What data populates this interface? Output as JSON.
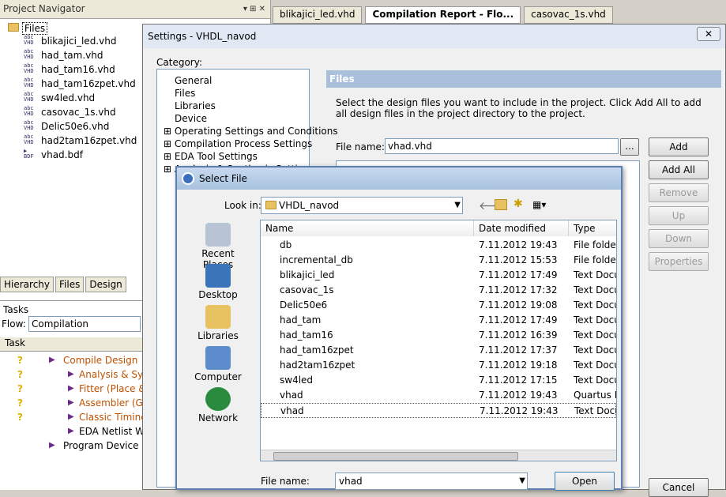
{
  "project_navigator": {
    "title": "Project Navigator",
    "root": "Files",
    "files": [
      {
        "icon": "vhd",
        "name": "blikajici_led.vhd"
      },
      {
        "icon": "vhd",
        "name": "had_tam.vhd"
      },
      {
        "icon": "vhd",
        "name": "had_tam16.vhd"
      },
      {
        "icon": "vhd",
        "name": "had_tam16zpet.vhd"
      },
      {
        "icon": "vhd",
        "name": "sw4led.vhd"
      },
      {
        "icon": "vhd",
        "name": "casovac_1s.vhd"
      },
      {
        "icon": "vhd",
        "name": "Delic50e6.vhd"
      },
      {
        "icon": "vhd",
        "name": "had2tam16zpet.vhd"
      },
      {
        "icon": "bdf",
        "name": "vhad.bdf"
      }
    ],
    "bottom_tabs": [
      "Hierarchy",
      "Files",
      "Design"
    ]
  },
  "top_tabs": [
    "blikajici_led.vhd",
    "Compilation Report - Flo...",
    "casovac_1s.vhd"
  ],
  "tasks": {
    "title": "Tasks",
    "flow_label": "Flow:",
    "flow_value": "Compilation",
    "column": "Task",
    "items": [
      "Compile Design",
      "Analysis & Synth",
      "Fitter (Place & R",
      "Assembler (Gene",
      "Classic Timing A",
      "EDA Netlist Write",
      "Program Device (Ope"
    ]
  },
  "settings": {
    "title": "Settings - VHDL_navod",
    "category_label": "Category:",
    "categories": [
      "General",
      "Files",
      "Libraries",
      "Device",
      "Operating Settings and Conditions",
      "Compilation Process Settings",
      "EDA Tool Settings",
      "Analysis & Synthesis Settings"
    ],
    "panel_title": "Files",
    "description": "Select the design files you want to include in the project. Click Add All to add all design files in the project directory to the project.",
    "file_name_label": "File name:",
    "file_name_value": "vhad.vhd",
    "browse_label": "...",
    "buttons": {
      "add": "Add",
      "add_all": "Add All",
      "remove": "Remove",
      "up": "Up",
      "down": "Down",
      "properties": "Properties",
      "cancel": "Cancel"
    }
  },
  "select_file": {
    "title": "Select File",
    "look_in_label": "Look in:",
    "look_in_value": "VHDL_navod",
    "places": [
      "Recent Places",
      "Desktop",
      "Libraries",
      "Computer",
      "Network"
    ],
    "columns": [
      "Name",
      "Date modified",
      "Type"
    ],
    "rows": [
      {
        "icon": "folder",
        "name": "db",
        "date": "7.11.2012 19:43",
        "type": "File folder"
      },
      {
        "icon": "folder",
        "name": "incremental_db",
        "date": "7.11.2012 15:53",
        "type": "File folder"
      },
      {
        "icon": "doc",
        "name": "blikajici_led",
        "date": "7.11.2012 17:49",
        "type": "Text Docu"
      },
      {
        "icon": "doc",
        "name": "casovac_1s",
        "date": "7.11.2012 17:32",
        "type": "Text Docu"
      },
      {
        "icon": "doc",
        "name": "Delic50e6",
        "date": "7.11.2012 19:08",
        "type": "Text Docu"
      },
      {
        "icon": "doc",
        "name": "had_tam",
        "date": "7.11.2012 17:49",
        "type": "Text Docu"
      },
      {
        "icon": "doc",
        "name": "had_tam16",
        "date": "7.11.2012 16:39",
        "type": "Text Docu"
      },
      {
        "icon": "doc",
        "name": "had_tam16zpet",
        "date": "7.11.2012 17:37",
        "type": "Text Docu"
      },
      {
        "icon": "doc",
        "name": "had2tam16zpet",
        "date": "7.11.2012 19:18",
        "type": "Text Docu"
      },
      {
        "icon": "doc",
        "name": "sw4led",
        "date": "7.11.2012 17:15",
        "type": "Text Docu"
      },
      {
        "icon": "bdf",
        "name": "vhad",
        "date": "7.11.2012 19:43",
        "type": "Quartus II"
      },
      {
        "icon": "doc",
        "name": "vhad",
        "date": "7.11.2012 19:43",
        "type": "Text Docu",
        "selected": true
      }
    ],
    "file_name_label": "File name:",
    "file_name_value": "vhad",
    "open_label": "Open"
  },
  "page": {
    "total_tasks_shown": 7
  }
}
